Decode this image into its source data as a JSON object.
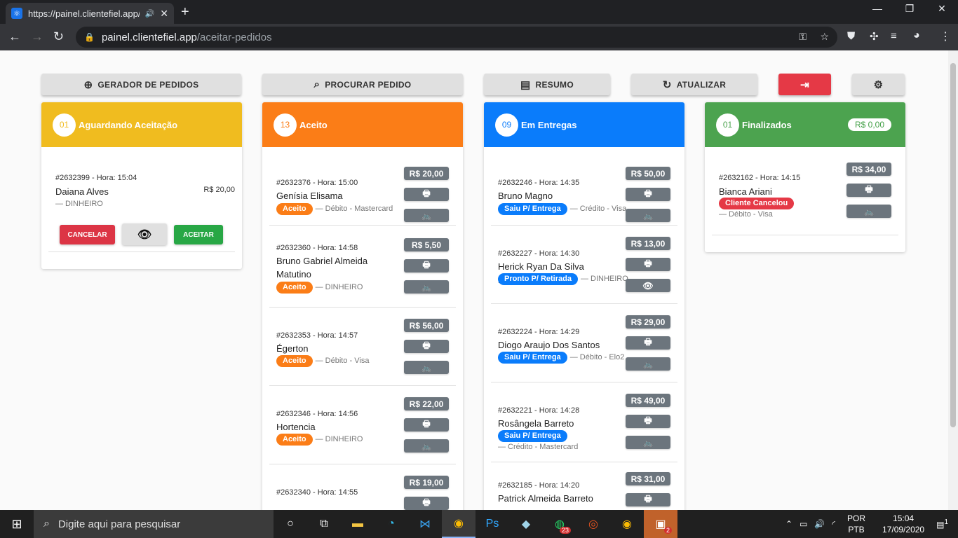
{
  "browser": {
    "tab_title": "https://painel.clientefiel.app/",
    "url_domain": "painel.clientefiel.app",
    "url_path": "/aceitar-pedidos"
  },
  "top_buttons": {
    "gerador": "GERADOR DE PEDIDOS",
    "procurar": "PROCURAR PEDIDO",
    "resumo": "RESUMO",
    "atualizar": "ATUALIZAR"
  },
  "columns": [
    {
      "count": "01",
      "title": "Aguardando Aceitação",
      "color": "#f0bc1f",
      "orders": [
        {
          "id": "#2632399 - Hora: 15:04",
          "name": "Daiana Alves",
          "payment": "— DINHEIRO",
          "price": "R$ 20,00"
        }
      ],
      "actions": {
        "cancel": "CANCELAR",
        "accept": "ACEITAR"
      }
    },
    {
      "count": "13",
      "title": "Aceito",
      "color": "#fb7d17",
      "orders": [
        {
          "id": "#2632376 - Hora: 15:00",
          "name": "Genísia Elisama",
          "status": "Aceito",
          "payment": "— Débito - Mastercard",
          "price": "R$ 20,00"
        },
        {
          "id": "#2632360 - Hora: 14:58",
          "name": "Bruno Gabriel Almeida Matutino",
          "status": "Aceito",
          "payment": "— DINHEIRO",
          "price": "R$ 5,50"
        },
        {
          "id": "#2632353 - Hora: 14:57",
          "name": "Égerton",
          "status": "Aceito",
          "payment": "— Débito - Visa",
          "price": "R$ 56,00"
        },
        {
          "id": "#2632346 - Hora: 14:56",
          "name": "Hortencia",
          "status": "Aceito",
          "payment": "— DINHEIRO",
          "price": "R$ 22,00"
        },
        {
          "id": "#2632340 - Hora: 14:55",
          "name": "",
          "status": "",
          "payment": "",
          "price": "R$ 19,00"
        }
      ]
    },
    {
      "count": "09",
      "title": "Em Entregas",
      "color": "#0a7cfb",
      "orders": [
        {
          "id": "#2632246 - Hora: 14:35",
          "name": "Bruno Magno",
          "status": "Saiu P/ Entrega",
          "payment": "— Crédito - Visa",
          "price": "R$ 50,00"
        },
        {
          "id": "#2632227 - Hora: 14:30",
          "name": "Herick Ryan Da Silva Pimente",
          "status": "Pronto P/ Retirada",
          "payment": "— DINHEIRO",
          "price": "R$ 13,00"
        },
        {
          "id": "#2632224 - Hora: 14:29",
          "name": "Diogo Araujo Dos Santos",
          "status": "Saiu P/ Entrega",
          "payment": "— Débito - Elo2",
          "price": "R$ 29,00"
        },
        {
          "id": "#2632221 - Hora: 14:28",
          "name": "Rosângela Barreto",
          "status": "Saiu P/ Entrega",
          "payment": "— Crédito - Mastercard",
          "price": "R$ 49,00"
        },
        {
          "id": "#2632185 - Hora: 14:20",
          "name": "Patrick Almeida Barreto",
          "status": "",
          "payment": "",
          "price": "R$ 31,00"
        }
      ]
    },
    {
      "count": "01",
      "title": "Finalizados",
      "color": "#4ca34f",
      "total": "R$ 0,00",
      "orders": [
        {
          "id": "#2632162 - Hora: 14:15",
          "name": "Bianca Ariani",
          "status": "Cliente Cancelou",
          "payment": "— Débito - Visa",
          "price": "R$ 34,00"
        }
      ]
    }
  ],
  "colors": {
    "accepted": "#fb7d17",
    "delivery": "#0a7cfb",
    "cancelled": "#e53946",
    "button_gray": "#6c757d",
    "accept_btn": "#28a745"
  },
  "taskbar": {
    "search_placeholder": "Digite aqui para pesquisar",
    "whatsapp_badge": "23",
    "app_badge": "2",
    "lang": "POR",
    "layout": "PTB",
    "time": "15:04",
    "date": "17/09/2020",
    "notifications": "1"
  }
}
